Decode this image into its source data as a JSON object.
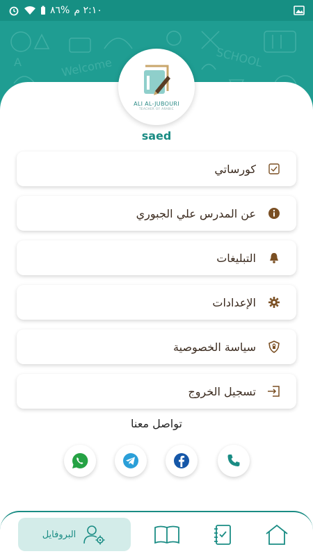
{
  "status_bar": {
    "time": "٢:١٠ م",
    "battery": "%٨٦"
  },
  "profile": {
    "logo_text": "ALI AL-JUBOURI",
    "logo_subtext": "TEACHER OF ARABIC",
    "username": "saed"
  },
  "menu": {
    "items": [
      {
        "label": "كورساتي",
        "icon": "checklist-icon"
      },
      {
        "label": "عن المدرس علي الجبوري",
        "icon": "info-icon"
      },
      {
        "label": "التبليغات",
        "icon": "bell-icon"
      },
      {
        "label": "الإعدادات",
        "icon": "gear-icon"
      },
      {
        "label": "سياسة الخصوصية",
        "icon": "shield-icon"
      },
      {
        "label": "تسجيل الخروج",
        "icon": "logout-icon"
      }
    ]
  },
  "contact": {
    "title": "تواصل معنا",
    "channels": [
      "whatsapp-icon",
      "telegram-icon",
      "facebook-icon",
      "phone-icon"
    ]
  },
  "bottom_nav": {
    "profile_label": "البروفايل",
    "items": [
      "profile-icon",
      "book-icon",
      "tasks-icon",
      "home-icon"
    ]
  },
  "colors": {
    "primary": "#1a8c84",
    "header": "#1f9d92",
    "icon_brown": "#7a4f23"
  }
}
